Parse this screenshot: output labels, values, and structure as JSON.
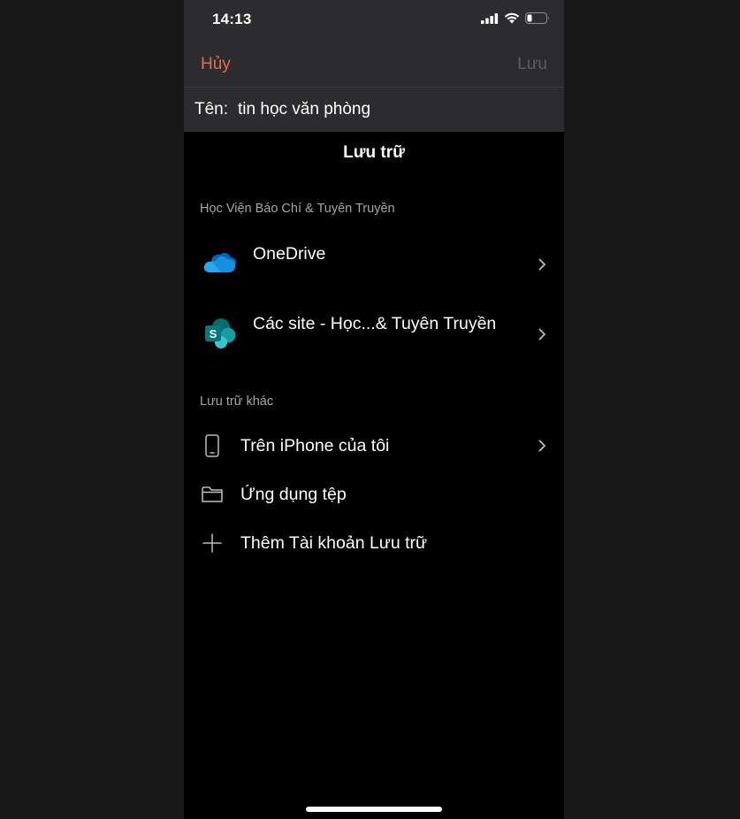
{
  "status_bar": {
    "time": "14:13"
  },
  "nav": {
    "cancel_label": "Hủy",
    "save_label": "Lưu"
  },
  "name_field": {
    "label": "Tên:",
    "value": "tin học văn phòng"
  },
  "sheet_title": "Lưu trữ",
  "org_section": {
    "header": "Học Viện Báo Chí & Tuyên Truyền",
    "items": [
      {
        "label": "OneDrive",
        "icon": "onedrive-icon"
      },
      {
        "label": "Các site - Học...& Tuyên Truyền",
        "icon": "sharepoint-icon"
      }
    ]
  },
  "other_section": {
    "header": "Lưu trữ khác",
    "items": [
      {
        "label": "Trên iPhone của tôi",
        "icon": "phone-icon"
      },
      {
        "label": "Ứng dụng tệp",
        "icon": "folder-icon"
      },
      {
        "label": "Thêm Tài khoản Lưu trữ",
        "icon": "plus-icon"
      }
    ]
  },
  "colors": {
    "accent": "#e06e52",
    "disabled": "#5d5d60",
    "top_background": "#2c2c2e",
    "background": "#000000"
  }
}
